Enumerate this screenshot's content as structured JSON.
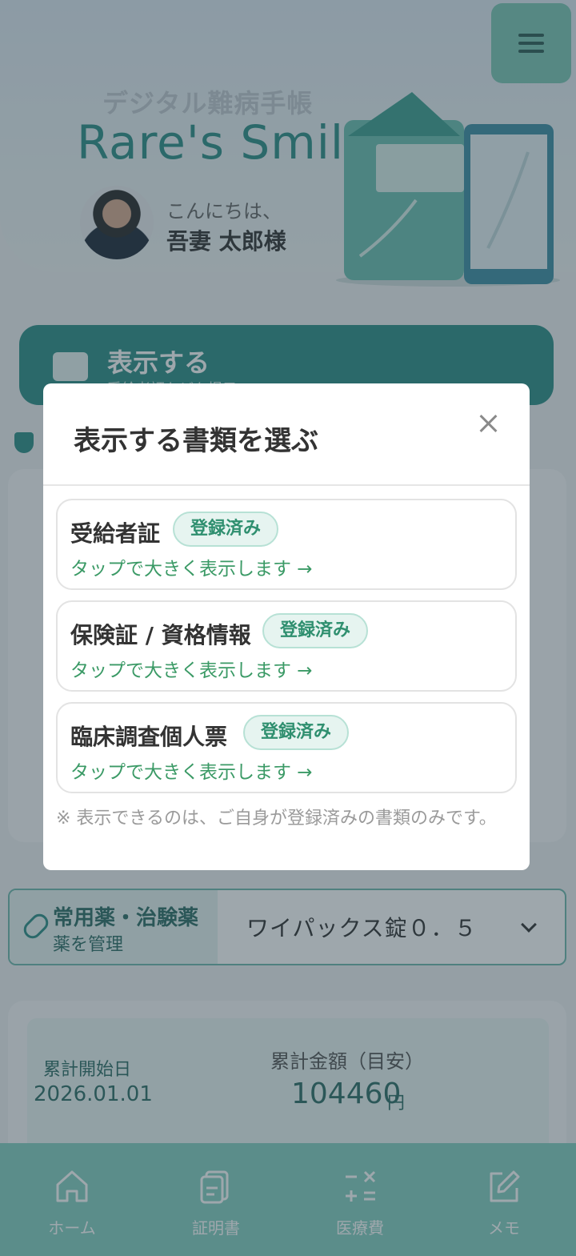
{
  "header": {
    "app_subtitle": "デジタル難病手帳",
    "app_title": "Rare's Smile",
    "greeting": "こんにちは、",
    "user_name": "吾妻 太郎様"
  },
  "show_button": {
    "label": "表示する",
    "sub": "受給者証などを提示"
  },
  "modal": {
    "title": "表示する書類を選ぶ",
    "documents": [
      {
        "name": "受給者証",
        "badge": "登録済み",
        "hint": "タップで大きく表示します →"
      },
      {
        "name": "保険証 / 資格情報",
        "badge": "登録済み",
        "hint": "タップで大きく表示します →"
      },
      {
        "name": "臨床調査個人票",
        "badge": "登録済み",
        "hint": "タップで大きく表示します →"
      }
    ],
    "note": "※ 表示できるのは、ご自身が登録済みの書類のみです。"
  },
  "medicine": {
    "title": "常用薬・治験薬",
    "subtitle": "薬を管理",
    "selected": "ワイパックス錠０．５"
  },
  "cost": {
    "start_label": "累計開始日",
    "start_date": "2026.01.01",
    "total_label": "累計金額（目安）",
    "total_value": "104460",
    "unit": "円"
  },
  "bottom_nav": [
    {
      "label": "ホーム",
      "icon": "home-icon"
    },
    {
      "label": "証明書",
      "icon": "document-icon"
    },
    {
      "label": "医療費",
      "icon": "calculator-icon"
    },
    {
      "label": "メモ",
      "icon": "edit-icon"
    }
  ],
  "colors": {
    "primary": "#2f8f87",
    "nav": "#86cfc1",
    "badge_bg": "#e6f4f0",
    "badge_text": "#2f8f6f"
  }
}
